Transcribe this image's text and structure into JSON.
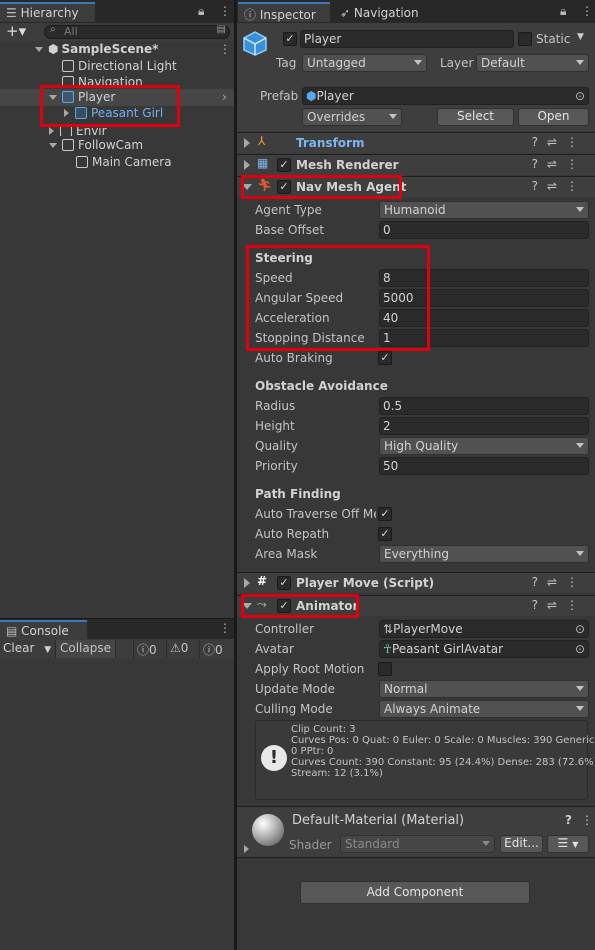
{
  "hierarchy": {
    "tab": "Hierarchy",
    "search_placeholder": "All",
    "items": [
      {
        "label": "SampleScene*"
      },
      {
        "label": "Directional Light"
      },
      {
        "label": "Navigation"
      },
      {
        "label": "Player"
      },
      {
        "label": "Peasant Girl"
      },
      {
        "label": "Envir"
      },
      {
        "label": "FollowCam"
      },
      {
        "label": "Main Camera"
      }
    ]
  },
  "console": {
    "tab": "Console",
    "clear": "Clear",
    "collapse": "Collapse",
    "counts": [
      "0",
      "0",
      "0"
    ]
  },
  "inspector": {
    "tabs": [
      "Inspector",
      "Navigation"
    ],
    "object_name": "Player",
    "static_label": "Static",
    "tag_label": "Tag",
    "tag_value": "Untagged",
    "layer_label": "Layer",
    "layer_value": "Default",
    "prefab_label": "Prefab",
    "prefab_value": "Player",
    "overrides": "Overrides",
    "select": "Select",
    "open": "Open",
    "components": {
      "transform": "Transform",
      "mesh_renderer": "Mesh Renderer",
      "nav_mesh_agent": "Nav Mesh Agent",
      "player_move": "Player Move (Script)",
      "animator": "Animator"
    },
    "nav": {
      "agent_type_label": "Agent Type",
      "agent_type": "Humanoid",
      "base_offset_label": "Base Offset",
      "base_offset": "0",
      "steering": "Steering",
      "speed_label": "Speed",
      "speed": "8",
      "angular_speed_label": "Angular Speed",
      "angular_speed": "5000",
      "acceleration_label": "Acceleration",
      "acceleration": "40",
      "stopping_distance_label": "Stopping Distance",
      "stopping_distance": "1",
      "auto_braking_label": "Auto Braking",
      "obstacle_avoidance": "Obstacle Avoidance",
      "radius_label": "Radius",
      "radius": "0.5",
      "height_label": "Height",
      "height": "2",
      "quality_label": "Quality",
      "quality": "High Quality",
      "priority_label": "Priority",
      "priority": "50",
      "path_finding": "Path Finding",
      "auto_traverse_label": "Auto Traverse Off Me",
      "auto_repath_label": "Auto Repath",
      "area_mask_label": "Area Mask",
      "area_mask": "Everything"
    },
    "animator": {
      "controller_label": "Controller",
      "controller": "PlayerMove",
      "avatar_label": "Avatar",
      "avatar": "Peasant GirlAvatar",
      "apply_root_motion_label": "Apply Root Motion",
      "update_mode_label": "Update Mode",
      "update_mode": "Normal",
      "culling_mode_label": "Culling Mode",
      "culling_mode": "Always Animate",
      "info": [
        "Clip Count: 3",
        "Curves Pos: 0 Quat: 0 Euler: 0 Scale: 0 Muscles: 390 Generic:",
        "0 PPtr: 0",
        "Curves Count: 390 Constant: 95 (24.4%) Dense: 283 (72.6%)",
        "Stream: 12 (3.1%)"
      ]
    },
    "material": {
      "name": "Default-Material (Material)",
      "shader_label": "Shader",
      "shader": "Standard",
      "edit": "Edit..."
    },
    "add_component": "Add Component"
  }
}
